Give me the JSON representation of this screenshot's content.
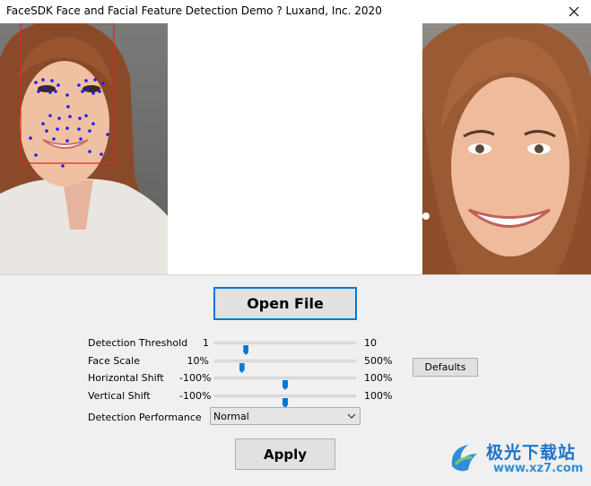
{
  "window": {
    "title": "FaceSDK Face and Facial Feature Detection Demo ? Luxand, Inc. 2020"
  },
  "buttons": {
    "open_file": "Open File",
    "apply": "Apply",
    "defaults": "Defaults"
  },
  "settings": [
    {
      "label": "Detection Threshold",
      "min": "1",
      "max": "10",
      "position": 0.22
    },
    {
      "label": "Face Scale",
      "min": "10%",
      "max": "500%",
      "position": 0.19
    },
    {
      "label": "Horizontal Shift",
      "min": "-100%",
      "max": "100%",
      "position": 0.5
    },
    {
      "label": "Vertical Shift",
      "min": "-100%",
      "max": "100%",
      "position": 0.5
    }
  ],
  "performance": {
    "label": "Detection Performance",
    "value": "Normal"
  },
  "watermark": {
    "name": "极光下载站",
    "url": "www.xz7.com"
  },
  "colors": {
    "accent": "#0078d7",
    "face_box": "#e0251c",
    "feature_points": "#1a1aff"
  }
}
